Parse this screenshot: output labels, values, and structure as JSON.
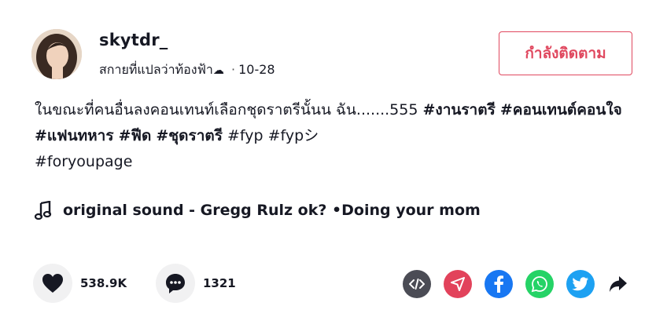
{
  "author": {
    "username": "skytdr_",
    "nickname": "สกายที่แปลว่าท้องฟ้า",
    "nickname_emoji": "☁",
    "date": "10-28",
    "separator": "·"
  },
  "follow_button": {
    "label": "กำลังติดตาม"
  },
  "caption": {
    "text": "ในขณะที่คนอื่นลงคอนเทนท์เลือกชุดราตรีนั้นน ฉัน.......555 ",
    "hashtags": [
      "#งานราตรี",
      "#คอนเทนต์คอนใจ",
      "#แฟนทหาร",
      "#ฟีด",
      "#ชุดราตรี",
      "#fyp",
      "#fypシ",
      "#foryoupage"
    ]
  },
  "music": {
    "label": "original sound - Gregg Rulz ok? •Doing your mom",
    "icon": "music-note-icon"
  },
  "actions": {
    "likes": "538.9K",
    "comments": "1321",
    "share_targets": [
      {
        "name": "embed",
        "icon": "embed-icon",
        "color": "#4b4c55"
      },
      {
        "name": "send",
        "icon": "send-icon",
        "color": "#e2425b"
      },
      {
        "name": "facebook",
        "icon": "facebook-icon",
        "color": "#1877f2"
      },
      {
        "name": "whatsapp",
        "icon": "whatsapp-icon",
        "color": "#25d366"
      },
      {
        "name": "twitter",
        "icon": "twitter-icon",
        "color": "#1da1f2"
      },
      {
        "name": "share",
        "icon": "share-arrow-icon",
        "color": "#161823"
      }
    ]
  },
  "colors": {
    "accent": "#e0485f",
    "text": "#161823",
    "button_bg": "#f1f1f2"
  }
}
